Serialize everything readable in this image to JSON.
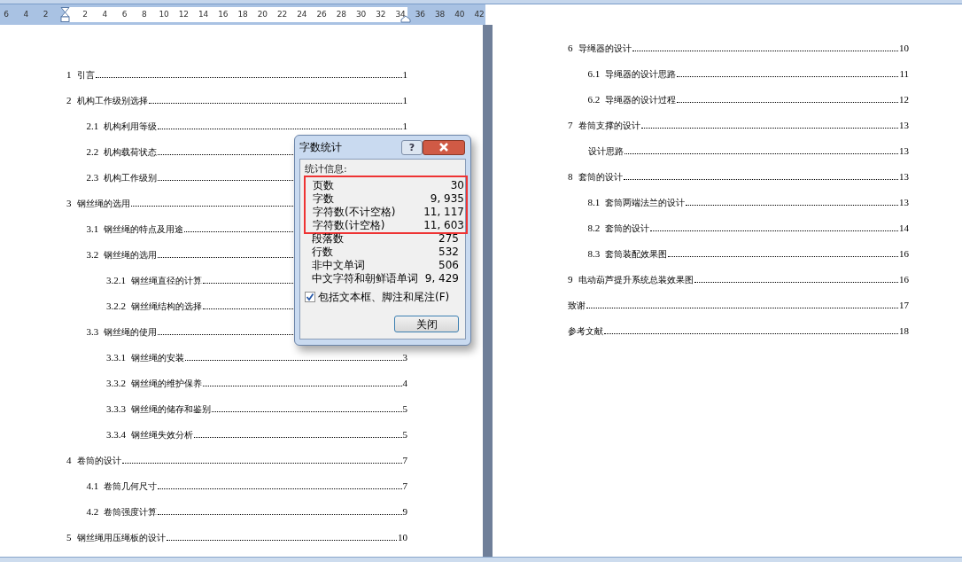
{
  "ruler": {
    "marks": [
      {
        "kind": "label",
        "text": "6"
      },
      {
        "kind": "label",
        "text": "4"
      },
      {
        "kind": "label",
        "text": "2"
      },
      {
        "kind": "indent"
      },
      {
        "kind": "label",
        "text": "2"
      },
      {
        "kind": "label",
        "text": "4"
      },
      {
        "kind": "label",
        "text": "6"
      },
      {
        "kind": "label",
        "text": "8"
      },
      {
        "kind": "label",
        "text": "10"
      },
      {
        "kind": "label",
        "text": "12"
      },
      {
        "kind": "label",
        "text": "14"
      },
      {
        "kind": "label",
        "text": "16"
      },
      {
        "kind": "label",
        "text": "18"
      },
      {
        "kind": "label",
        "text": "20"
      },
      {
        "kind": "label",
        "text": "22"
      },
      {
        "kind": "label",
        "text": "24"
      },
      {
        "kind": "label",
        "text": "26"
      },
      {
        "kind": "label",
        "text": "28"
      },
      {
        "kind": "label",
        "text": "30"
      },
      {
        "kind": "label",
        "text": "32"
      },
      {
        "kind": "label",
        "text": "34"
      },
      {
        "kind": "label",
        "text": "36"
      },
      {
        "kind": "label",
        "text": "38"
      },
      {
        "kind": "label",
        "text": "40"
      },
      {
        "kind": "label",
        "text": "42"
      }
    ]
  },
  "pages": [
    {
      "toc": [
        {
          "number": "1",
          "title": "引言",
          "page": "1"
        },
        {
          "number": "2",
          "title": "机构工作级别选择",
          "page": "1",
          "children": [
            {
              "number": "2.1",
              "title": "机构利用等级",
              "page": "1"
            },
            {
              "number": "2.2",
              "title": "机构载荷状态"
            },
            {
              "number": "2.3",
              "title": "机构工作级别"
            }
          ]
        },
        {
          "number": "3",
          "title": "钢丝绳的选用",
          "children": [
            {
              "number": "3.1",
              "title": "钢丝绳的特点及用途"
            },
            {
              "number": "3.2",
              "title": "钢丝绳的选用",
              "children": [
                {
                  "number": "3.2.1",
                  "title": "钢丝绳直径的计算"
                },
                {
                  "number": "3.2.2",
                  "title": "钢丝绳结构的选择"
                }
              ]
            },
            {
              "number": "3.3",
              "title": "钢丝绳的使用",
              "children": [
                {
                  "number": "3.3.1",
                  "title": "钢丝绳的安装",
                  "page": "3"
                },
                {
                  "number": "3.3.2",
                  "title": "钢丝绳的维护保养",
                  "page": "4"
                },
                {
                  "number": "3.3.3",
                  "title": "钢丝绳的储存和鉴别",
                  "page": "5"
                },
                {
                  "number": "3.3.4",
                  "title": "钢丝绳失效分析",
                  "page": "5"
                }
              ]
            }
          ]
        },
        {
          "number": "4",
          "title": "卷筒的设计",
          "page": "7",
          "children": [
            {
              "number": "4.1",
              "title": "卷筒几何尺寸",
              "page": "7"
            },
            {
              "number": "4.2",
              "title": "卷筒强度计算",
              "page": "9"
            }
          ]
        },
        {
          "number": "5",
          "title": "钢丝绳用压绳板的设计",
          "page": "10"
        }
      ]
    },
    {
      "toc": [
        {
          "number": "6",
          "title": "导绳器的设计",
          "page": "10",
          "children": [
            {
              "number": "6.1",
              "title": "导绳器的设计思路",
              "page": "11"
            },
            {
              "number": "6.2",
              "title": "导绳器的设计过程",
              "page": "12"
            }
          ]
        },
        {
          "number": "7",
          "title": "卷筒支撑的设计",
          "page": "13",
          "children": [
            {
              "title": "设计思路",
              "page": "13"
            }
          ]
        },
        {
          "number": "8",
          "title": "套筒的设计",
          "page": "13",
          "children": [
            {
              "number": "8.1",
              "title": "套筒两端法兰的设计",
              "page": "13"
            },
            {
              "number": "8.2",
              "title": "套筒的设计",
              "page": "14"
            },
            {
              "number": "8.3",
              "title": "套筒装配效果图",
              "page": "16"
            }
          ]
        },
        {
          "number": "9",
          "title": "电动葫芦提升系统总装效果图",
          "page": "16"
        },
        {
          "title": "致谢",
          "page": "17"
        },
        {
          "title": "参考文献",
          "page": "18"
        }
      ]
    }
  ],
  "dialog": {
    "title": "字数统计",
    "help": "?",
    "group_label": "统计信息:",
    "stats": [
      {
        "label": "页数",
        "value": "30",
        "highlighted": true
      },
      {
        "label": "字数",
        "value": "9, 935",
        "highlighted": true
      },
      {
        "label": "字符数(不计空格)",
        "value": "11, 117",
        "highlighted": true
      },
      {
        "label": "字符数(计空格)",
        "value": "11, 603",
        "highlighted": true
      },
      {
        "label": "段落数",
        "value": "275",
        "highlighted": false
      },
      {
        "label": "行数",
        "value": "532",
        "highlighted": false
      },
      {
        "label": "非中文单词",
        "value": "506",
        "highlighted": false
      },
      {
        "label": "中文字符和朝鲜语单词",
        "value": "9, 429",
        "highlighted": false
      }
    ],
    "checkbox": {
      "label": "包括文本框、脚注和尾注(F)",
      "checked": true
    },
    "button": "关闭"
  }
}
